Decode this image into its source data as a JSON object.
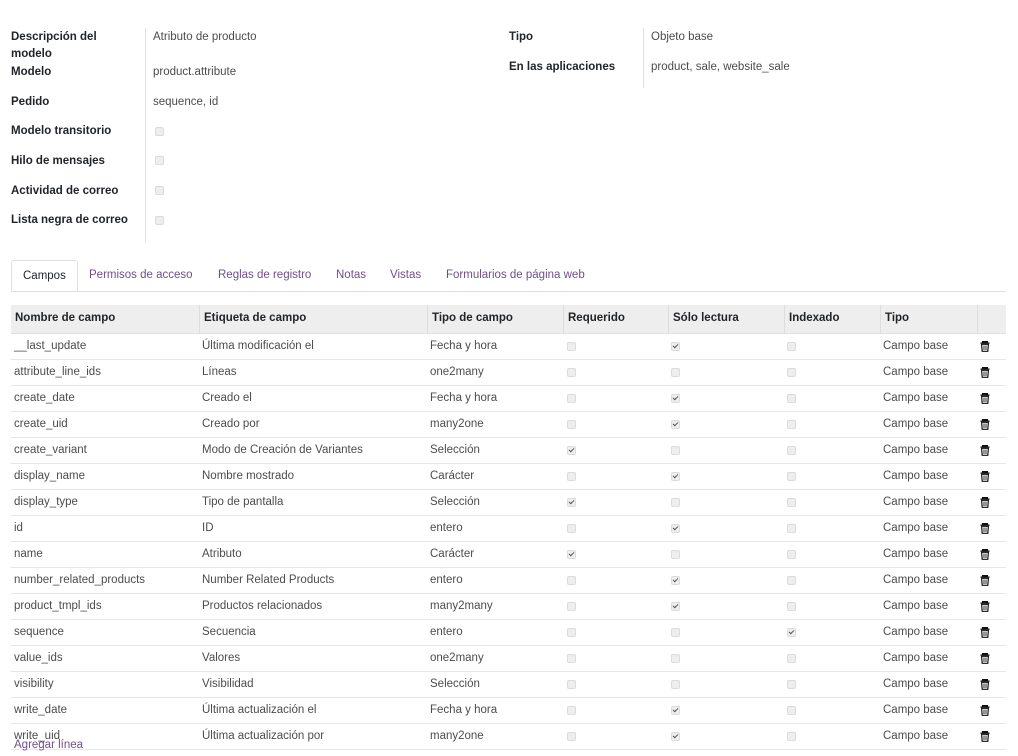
{
  "form": {
    "left": [
      {
        "label": "Descripción del modelo",
        "value": "Atributo de producto"
      },
      {
        "label": "Modelo",
        "value": "product.attribute"
      },
      {
        "label": "Pedido",
        "value": "sequence, id"
      },
      {
        "label": "Modelo transitorio",
        "checked": false
      },
      {
        "label": "Hilo de mensajes",
        "checked": false
      },
      {
        "label": "Actividad de correo",
        "checked": false
      },
      {
        "label": "Lista negra de correo",
        "checked": false
      }
    ],
    "right": [
      {
        "label": "Tipo",
        "value": "Objeto base"
      },
      {
        "label": "En las aplicaciones",
        "value": "product, sale, website_sale"
      }
    ]
  },
  "tabs": [
    "Campos",
    "Permisos de acceso",
    "Reglas de registro",
    "Notas",
    "Vistas",
    "Formularios de página web"
  ],
  "active_tab": "Campos",
  "table": {
    "headers": [
      "Nombre de campo",
      "Etiqueta de campo",
      "Tipo de campo",
      "Requerido",
      "Sólo lectura",
      "Indexado",
      "Tipo"
    ],
    "rows": [
      {
        "name": "__last_update",
        "label": "Última modificación el",
        "type": "Fecha y hora",
        "required": false,
        "readonly": true,
        "indexed": false,
        "kind": "Campo base"
      },
      {
        "name": "attribute_line_ids",
        "label": "Líneas",
        "type": "one2many",
        "required": false,
        "readonly": false,
        "indexed": false,
        "kind": "Campo base"
      },
      {
        "name": "create_date",
        "label": "Creado el",
        "type": "Fecha y hora",
        "required": false,
        "readonly": true,
        "indexed": false,
        "kind": "Campo base"
      },
      {
        "name": "create_uid",
        "label": "Creado por",
        "type": "many2one",
        "required": false,
        "readonly": true,
        "indexed": false,
        "kind": "Campo base"
      },
      {
        "name": "create_variant",
        "label": "Modo de Creación de Variantes",
        "type": "Selección",
        "required": true,
        "readonly": false,
        "indexed": false,
        "kind": "Campo base"
      },
      {
        "name": "display_name",
        "label": "Nombre mostrado",
        "type": "Carácter",
        "required": false,
        "readonly": true,
        "indexed": false,
        "kind": "Campo base"
      },
      {
        "name": "display_type",
        "label": "Tipo de pantalla",
        "type": "Selección",
        "required": true,
        "readonly": false,
        "indexed": false,
        "kind": "Campo base"
      },
      {
        "name": "id",
        "label": "ID",
        "type": "entero",
        "required": false,
        "readonly": true,
        "indexed": false,
        "kind": "Campo base"
      },
      {
        "name": "name",
        "label": "Atributo",
        "type": "Carácter",
        "required": true,
        "readonly": false,
        "indexed": false,
        "kind": "Campo base"
      },
      {
        "name": "number_related_products",
        "label": "Number Related Products",
        "type": "entero",
        "required": false,
        "readonly": true,
        "indexed": false,
        "kind": "Campo base"
      },
      {
        "name": "product_tmpl_ids",
        "label": "Productos relacionados",
        "type": "many2many",
        "required": false,
        "readonly": true,
        "indexed": false,
        "kind": "Campo base"
      },
      {
        "name": "sequence",
        "label": "Secuencia",
        "type": "entero",
        "required": false,
        "readonly": false,
        "indexed": true,
        "kind": "Campo base"
      },
      {
        "name": "value_ids",
        "label": "Valores",
        "type": "one2many",
        "required": false,
        "readonly": false,
        "indexed": false,
        "kind": "Campo base"
      },
      {
        "name": "visibility",
        "label": "Visibilidad",
        "type": "Selección",
        "required": false,
        "readonly": false,
        "indexed": false,
        "kind": "Campo base"
      },
      {
        "name": "write_date",
        "label": "Última actualización el",
        "type": "Fecha y hora",
        "required": false,
        "readonly": true,
        "indexed": false,
        "kind": "Campo base"
      },
      {
        "name": "write_uid",
        "label": "Última actualización por",
        "type": "many2one",
        "required": false,
        "readonly": true,
        "indexed": false,
        "kind": "Campo base"
      }
    ]
  },
  "add_line": "Agregar línea",
  "icons": {
    "delete": "trash-icon"
  },
  "colors": {
    "link": "#6f4f8a",
    "header_bg": "#eeeeee"
  }
}
